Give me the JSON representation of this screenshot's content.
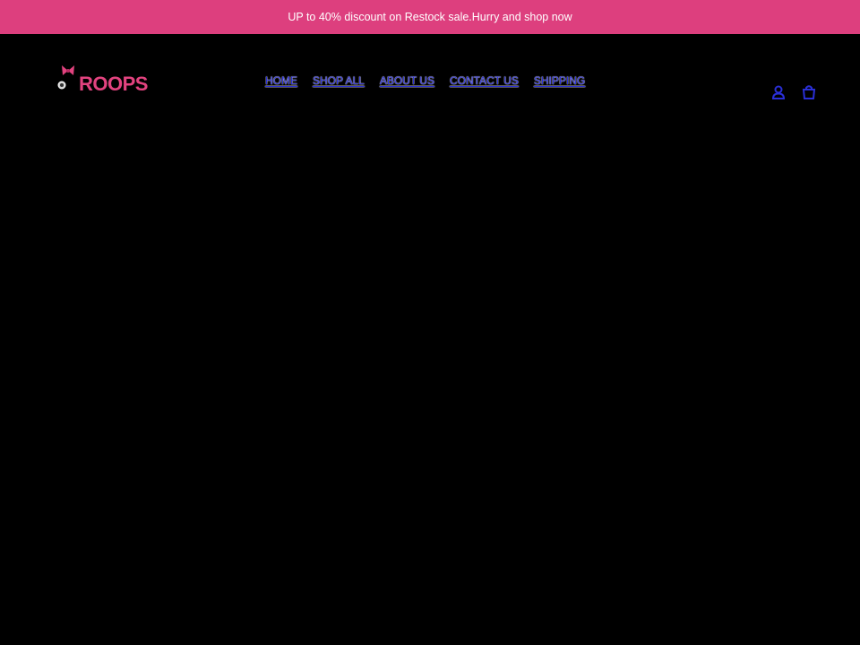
{
  "announcement": {
    "text": "UP to 40% discount on Restock sale.Hurry and shop now"
  },
  "brand": {
    "name": "ROOPS",
    "accent_color": "#dd3f7e",
    "logo_color": "#e2437f"
  },
  "nav": {
    "items": [
      {
        "label": "HOME"
      },
      {
        "label": "SHOP ALL"
      },
      {
        "label": "ABOUT US"
      },
      {
        "label": "CONTACT US"
      },
      {
        "label": "SHIPPING"
      }
    ],
    "link_color": "#2a2fd6"
  },
  "header_icons": {
    "account": "user-icon",
    "cart": "cart-icon"
  }
}
